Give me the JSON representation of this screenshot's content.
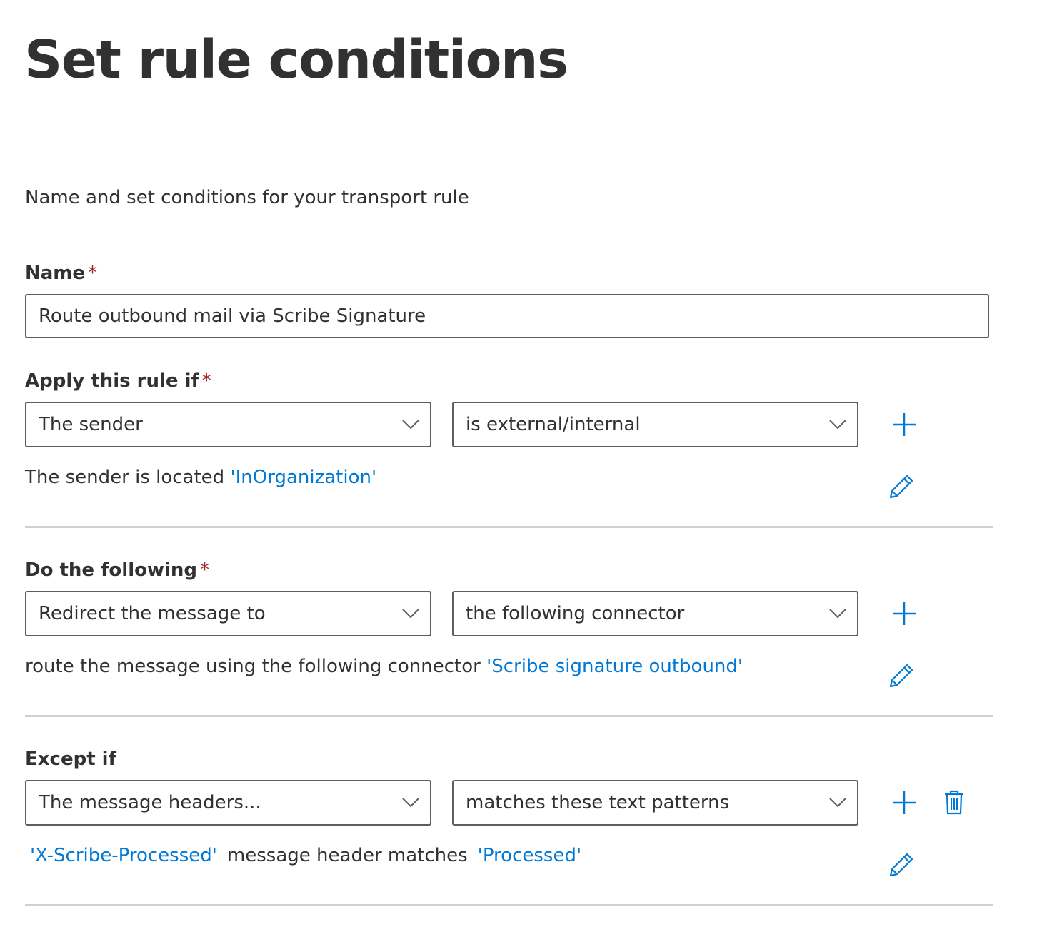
{
  "page": {
    "title": "Set rule conditions",
    "subtitle": "Name and set conditions for your transport rule"
  },
  "name_field": {
    "label": "Name",
    "required_marker": "*",
    "value": "Route outbound mail via Scribe Signature"
  },
  "apply_rule": {
    "label": "Apply this rule if",
    "required_marker": "*",
    "condition": "The sender",
    "operator": "is external/internal",
    "description_text": "The sender is located",
    "description_value": "'InOrganization'"
  },
  "do_following": {
    "label": "Do the following",
    "required_marker": "*",
    "action": "Redirect the message to",
    "target": "the following connector",
    "description_text": "route the message using the following connector",
    "description_value": "'Scribe signature outbound'"
  },
  "except_if": {
    "label": "Except if",
    "condition": "The message headers...",
    "operator": "matches these text patterns",
    "description_header": "'X-Scribe-Processed'",
    "description_text": "message header matches",
    "description_value": "'Processed'"
  },
  "colors": {
    "accent": "#0078d4",
    "required": "#a4262c",
    "text": "#323130",
    "border": "#605e5c",
    "divider": "#d2d0ce"
  },
  "icons": [
    "chevron-down-icon",
    "plus-icon",
    "pencil-icon",
    "trash-icon"
  ]
}
